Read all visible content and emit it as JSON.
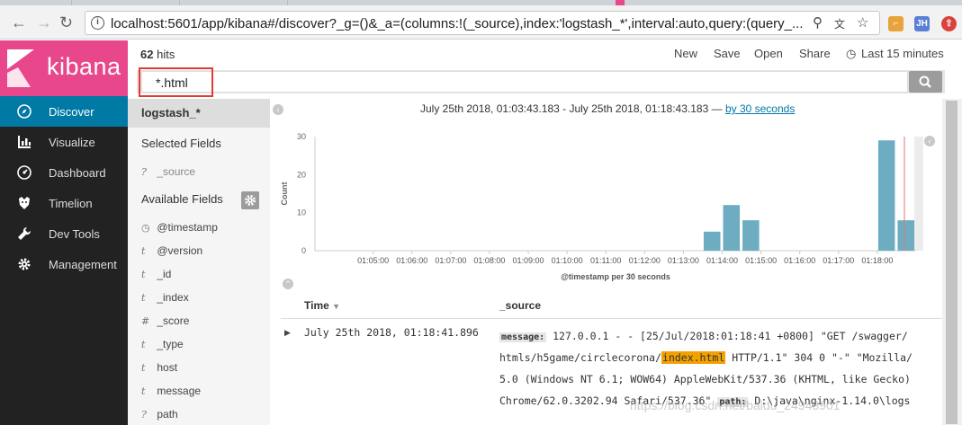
{
  "browser": {
    "url": "localhost:5601/app/kibana#/discover?_g=()&_a=(columns:!(_source),index:'logstash_*',interval:auto,query:(query_..."
  },
  "app": {
    "logo_text": "kibana",
    "brand_color": "#e8488b",
    "accent_color": "#0079a5"
  },
  "sidebar": {
    "items": [
      {
        "label": "Discover",
        "icon": "compass-icon",
        "active": true
      },
      {
        "label": "Visualize",
        "icon": "bar-chart-icon",
        "active": false
      },
      {
        "label": "Dashboard",
        "icon": "dashboard-icon",
        "active": false
      },
      {
        "label": "Timelion",
        "icon": "timelion-icon",
        "active": false
      },
      {
        "label": "Dev Tools",
        "icon": "wrench-icon",
        "active": false
      },
      {
        "label": "Management",
        "icon": "gear-icon",
        "active": false
      }
    ]
  },
  "topbar": {
    "hits_count": "62",
    "hits_label": "hits",
    "new": "New",
    "save": "Save",
    "open": "Open",
    "share": "Share",
    "timepicker": "Last 15 minutes"
  },
  "search": {
    "query": "*.html"
  },
  "fields": {
    "index": "logstash_*",
    "selected_title": "Selected Fields",
    "selected": [
      {
        "type": "?",
        "name": "_source"
      }
    ],
    "available_title": "Available Fields",
    "available": [
      {
        "type": "clock",
        "name": "@timestamp"
      },
      {
        "type": "t",
        "name": "@version"
      },
      {
        "type": "t",
        "name": "_id"
      },
      {
        "type": "t",
        "name": "_index"
      },
      {
        "type": "#",
        "name": "_score"
      },
      {
        "type": "t",
        "name": "_type"
      },
      {
        "type": "t",
        "name": "host"
      },
      {
        "type": "t",
        "name": "message"
      },
      {
        "type": "?",
        "name": "path"
      }
    ]
  },
  "timerange": {
    "text": "July 25th 2018, 01:03:43.183 - July 25th 2018, 01:18:43.183 —",
    "interval_link": "by 30 seconds"
  },
  "chart_data": {
    "type": "bar",
    "ylabel": "Count",
    "xlabel": "@timestamp per 30 seconds",
    "ylim": [
      0,
      30
    ],
    "yticks": [
      0,
      10,
      20,
      30
    ],
    "x_ticks": [
      "01:05:00",
      "01:06:00",
      "01:07:00",
      "01:08:00",
      "01:09:00",
      "01:10:00",
      "01:11:00",
      "01:12:00",
      "01:13:00",
      "01:14:00",
      "01:15:00",
      "01:16:00",
      "01:17:00",
      "01:18:00"
    ],
    "bars": [
      {
        "x": "01:13:30",
        "value": 5
      },
      {
        "x": "01:14:00",
        "value": 12
      },
      {
        "x": "01:14:30",
        "value": 8
      },
      {
        "x": "01:18:00",
        "value": 29
      },
      {
        "x": "01:18:30",
        "value": 8
      }
    ],
    "bar_color": "#6eadc1"
  },
  "documents": {
    "headers": {
      "time": "Time",
      "source": "_source"
    },
    "rows": [
      {
        "time": "July 25th 2018, 01:18:41.896",
        "message_key": "message:",
        "line1": "127.0.0.1 - - [25/Jul/2018:01:18:41 +0800] \"GET /swagger/",
        "line2_pre": "htmls/h5game/circlecorona/",
        "line2_hl": "index.html",
        "line2_post": " HTTP/1.1\" 304 0 \"-\" \"Mozilla/",
        "line3": "5.0 (Windows NT 6.1; WOW64) AppleWebKit/537.36 (KHTML, like Gecko)",
        "line4_pre": "Chrome/62.0.3202.94 Safari/537.36\"",
        "path_key": "path:",
        "line4_post": "D:\\java\\nginx-1.14.0\\logs"
      }
    ]
  },
  "watermark": "https://blog.csdn.net/baidu_24943901"
}
